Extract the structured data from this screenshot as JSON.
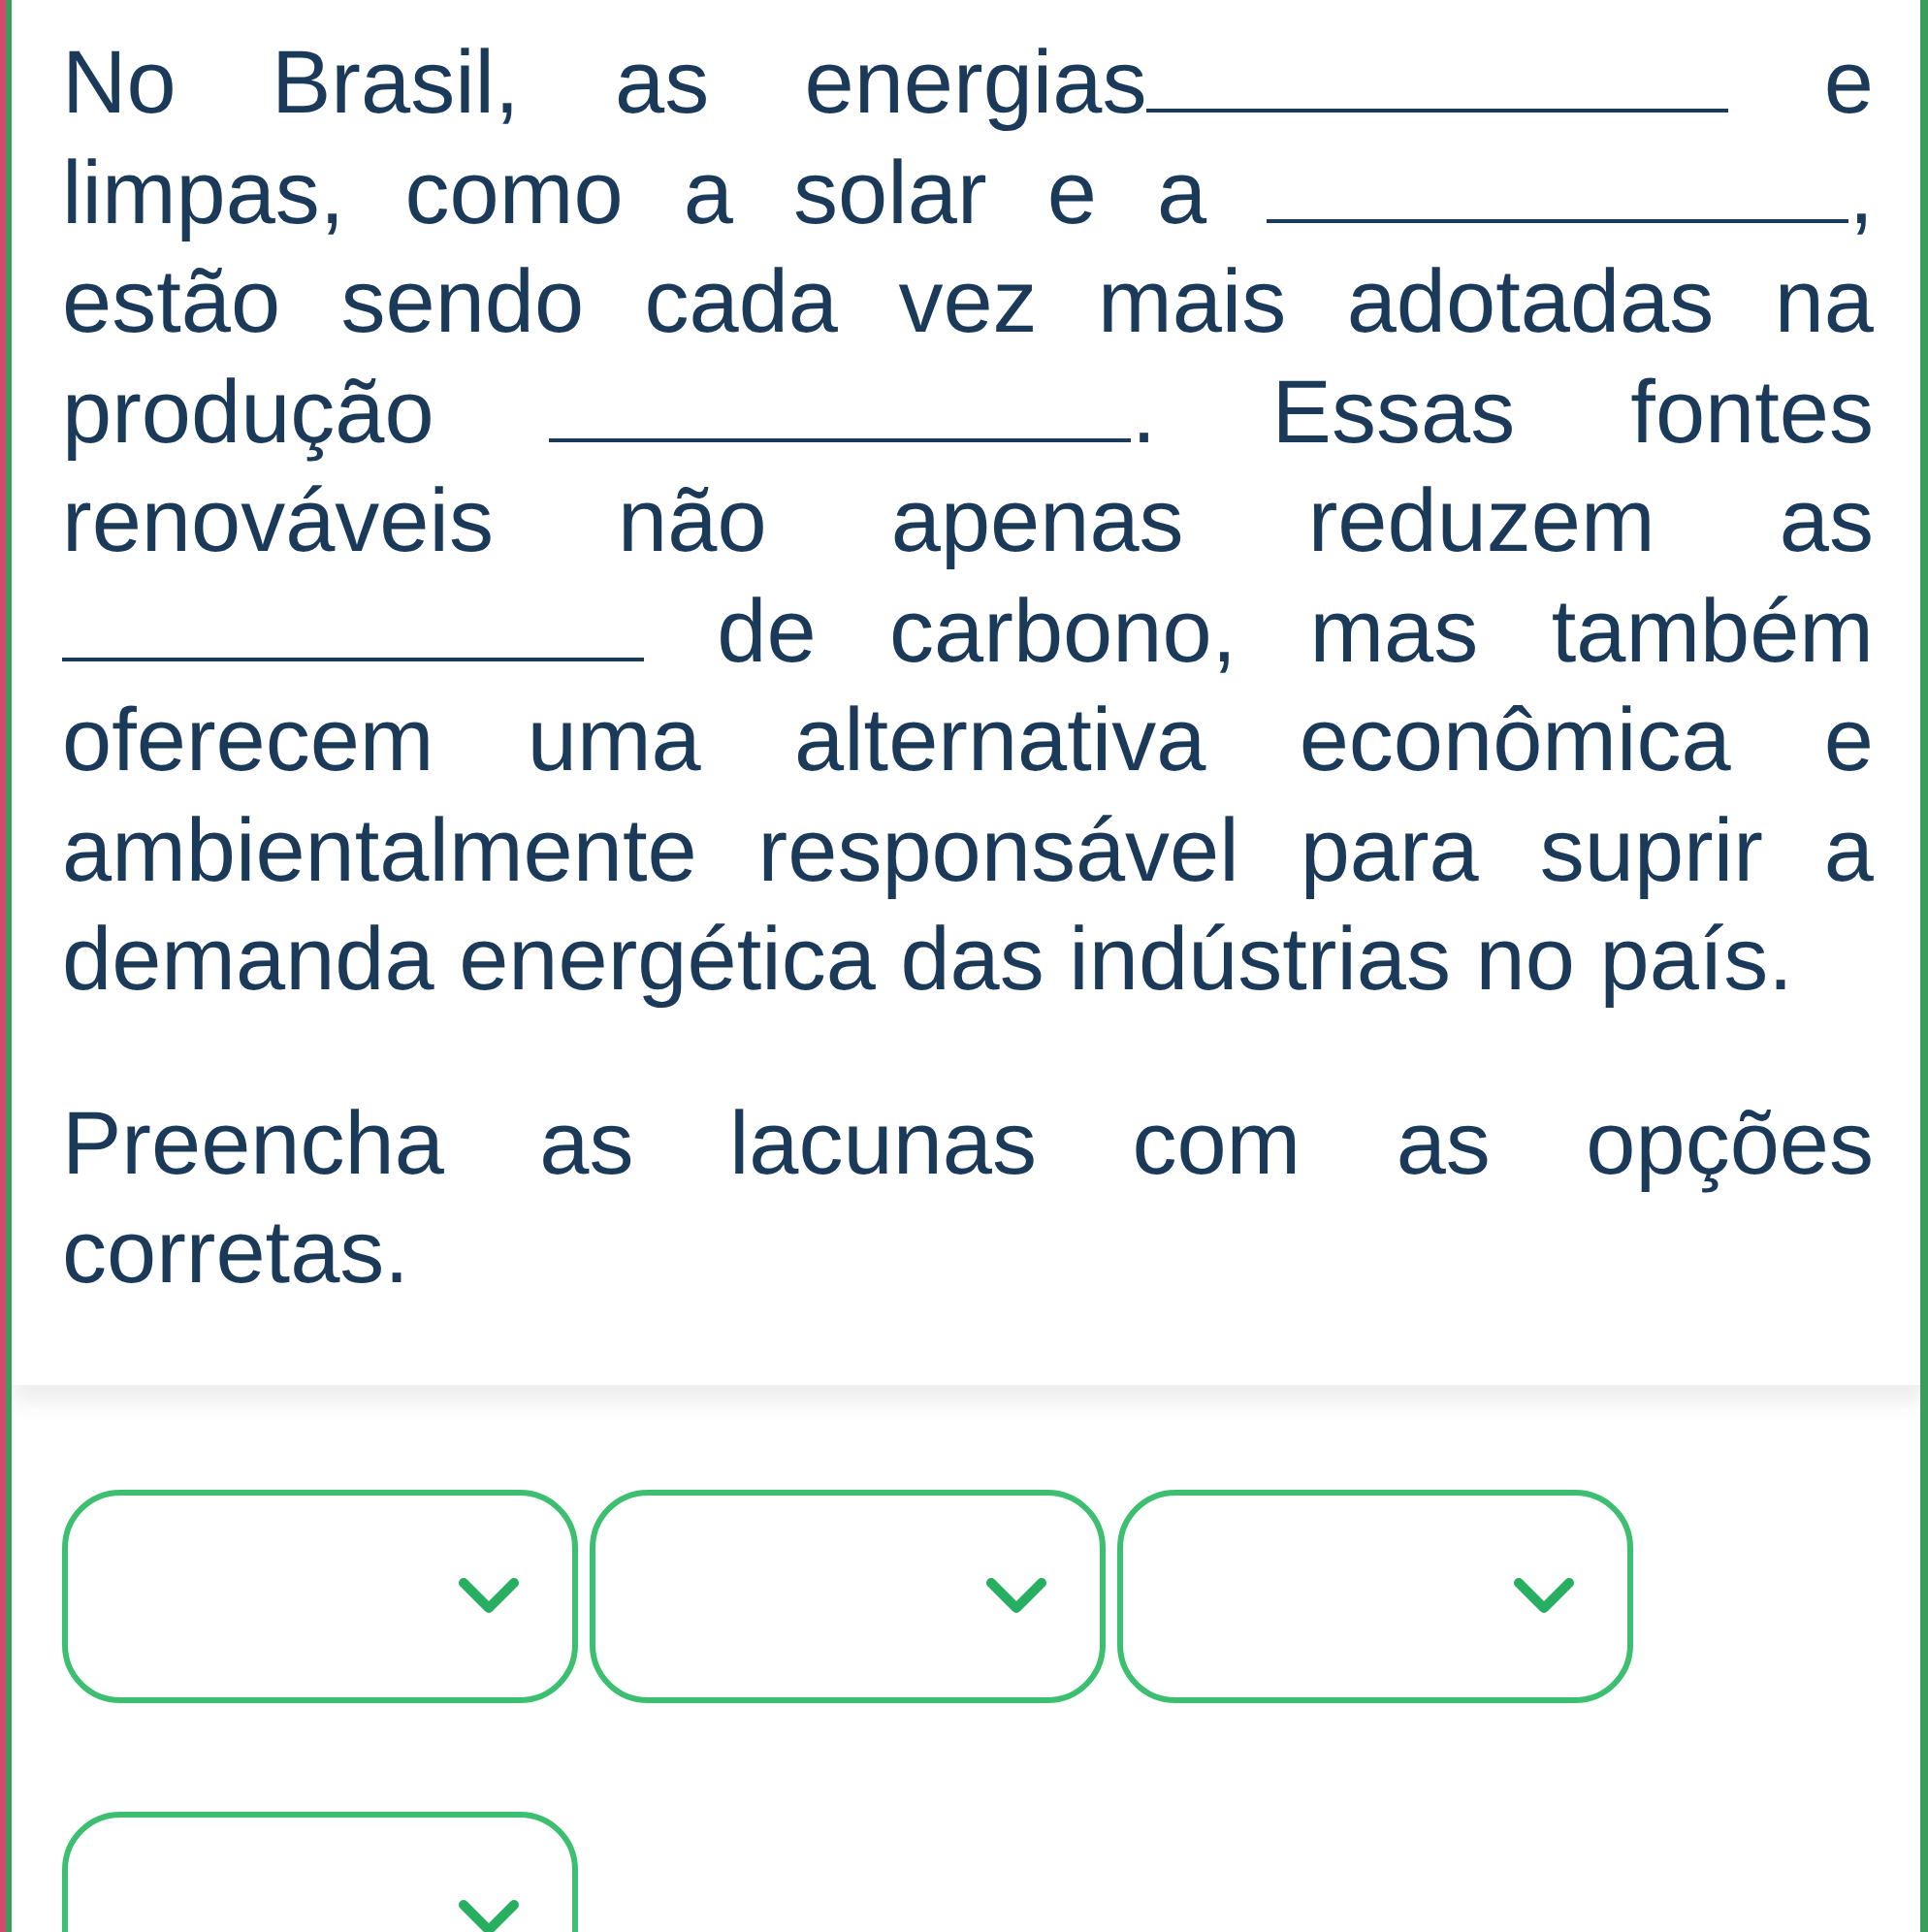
{
  "question": {
    "passage": [
      {
        "kind": "text",
        "text": "No Brasil, as energias"
      },
      {
        "kind": "blank"
      },
      {
        "kind": "text",
        "text": " e limpas, como a solar e a "
      },
      {
        "kind": "blank"
      },
      {
        "kind": "text",
        "text": ", estão sendo cada vez mais adotadas na produção "
      },
      {
        "kind": "blank"
      },
      {
        "kind": "text",
        "text": ". Essas fontes renováveis não apenas reduzem as "
      },
      {
        "kind": "blank"
      },
      {
        "kind": "text",
        "text": " de carbono, mas também oferecem uma alternativa econômica e ambientalmente responsável para suprir a demanda energética das indústrias no país."
      }
    ],
    "instruction": "Preencha as lacunas com as opções corretas."
  },
  "dropdowns": [
    {
      "expanded": false
    },
    {
      "expanded": false
    },
    {
      "expanded": false
    },
    {
      "expanded": false
    }
  ]
}
